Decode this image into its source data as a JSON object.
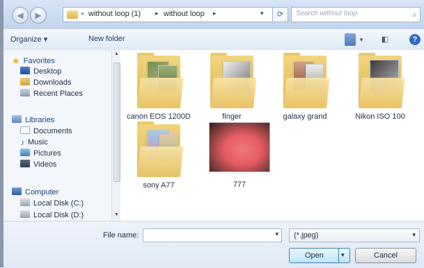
{
  "address_bar": {
    "path": [
      "without loop (1)",
      "without loop"
    ],
    "chevron": "«",
    "separator": "▸",
    "dropdown": "▾",
    "refresh_icon": "⟳",
    "search_placeholder": "Search without loop"
  },
  "toolbar": {
    "organize_label": "Organize ▾",
    "new_folder_label": "New folder"
  },
  "nav_pane": {
    "favorites": {
      "label": "Favorites",
      "items": [
        "Desktop",
        "Downloads",
        "Recent Places"
      ]
    },
    "libraries": {
      "label": "Libraries",
      "items": [
        "Documents",
        "Music",
        "Pictures",
        "Videos"
      ]
    },
    "computer": {
      "label": "Computer",
      "items": [
        "Local Disk (C:)",
        "Local Disk (D:)"
      ]
    }
  },
  "content": {
    "items": [
      {
        "name": "canon EOS 1200D",
        "type": "folder"
      },
      {
        "name": "finger",
        "type": "folder"
      },
      {
        "name": "galaxy grand",
        "type": "folder"
      },
      {
        "name": "Nikon ISO 100",
        "type": "folder"
      },
      {
        "name": "sony A77",
        "type": "folder"
      },
      {
        "name": "777",
        "type": "image"
      }
    ]
  },
  "bottom": {
    "file_name_label": "File name:",
    "file_name_value": "",
    "file_type_value": "(*.jpeg)",
    "open_label": "Open",
    "cancel_label": "Cancel"
  },
  "colors": {
    "accent": "#3c7fb1",
    "folder": "#ddb44f",
    "nav_bg": "#f3f7fc"
  }
}
